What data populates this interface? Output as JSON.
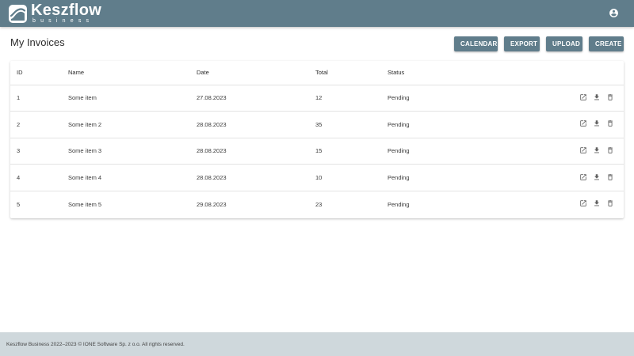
{
  "header": {
    "brand_name": "Keszflow",
    "brand_sub": "business",
    "account_icon": "account-circle-icon",
    "colors": {
      "bar": "#607d8b"
    }
  },
  "page": {
    "title": "My Invoices"
  },
  "toolbar": {
    "calendar_label": "CALENDAR",
    "export_label": "EXPORT",
    "upload_label": "UPLOAD",
    "create_label": "CREATE"
  },
  "table": {
    "headers": {
      "id": "ID",
      "name": "Name",
      "date": "Date",
      "total": "Total",
      "status": "Status"
    },
    "rows": [
      {
        "id": "1",
        "name": "Some item",
        "date": "27.08.2023",
        "total": "12",
        "status": "Pending"
      },
      {
        "id": "2",
        "name": "Some item 2",
        "date": "28.08.2023",
        "total": "35",
        "status": "Pending"
      },
      {
        "id": "3",
        "name": "Some item 3",
        "date": "28.08.2023",
        "total": "15",
        "status": "Pending"
      },
      {
        "id": "4",
        "name": "Some item 4",
        "date": "28.08.2023",
        "total": "10",
        "status": "Pending"
      },
      {
        "id": "5",
        "name": "Some item 5",
        "date": "29.08.2023",
        "total": "23",
        "status": "Pending"
      }
    ],
    "row_action_icons": [
      "open-in-new-icon",
      "download-icon",
      "delete-icon"
    ]
  },
  "footer": {
    "text": "Keszflow Business 2022–2023 © IONE Software Sp. z o.o. All rights reserved."
  }
}
